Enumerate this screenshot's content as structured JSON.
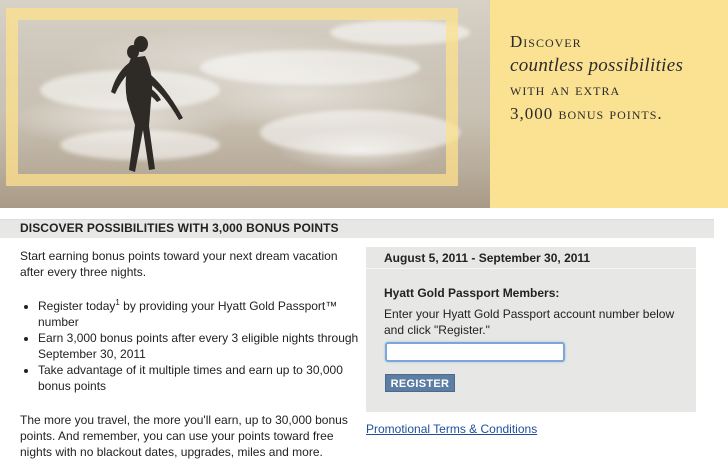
{
  "hero": {
    "panel_lines": [
      "Discover",
      "countless possibilities",
      "with an extra",
      "3,000 bonus points."
    ]
  },
  "section": {
    "title": "DISCOVER POSSIBILITIES WITH 3,000 BONUS POINTS"
  },
  "content": {
    "intro": "Start earning bonus points toward your next dream vacation after every three nights.",
    "bullets": [
      {
        "text_before": "Register today",
        "sup": "1",
        "text_after": " by providing your Hyatt Gold Passport™ number"
      },
      {
        "text": "Earn 3,000 bonus points after every 3 eligible nights through September 30, 2011"
      },
      {
        "text": "Take advantage of it multiple times and earn up to 30,000 bonus points"
      }
    ],
    "outro": "The more you travel, the more you'll earn, up to 30,000 bonus points. And remember, you can use your points toward free nights with no blackout dates, upgrades, miles and more."
  },
  "register_box": {
    "date_range": "August 5, 2011 - September 30, 2011",
    "heading": "Hyatt Gold Passport Members:",
    "instructions": "Enter your Hyatt Gold Passport account number below and click \"Register.\"",
    "account_value": "",
    "button_label": "REGISTER"
  },
  "terms_link": "Promotional Terms & Conditions",
  "colors": {
    "panel_bg": "#fbe192",
    "frame": "#fde28c",
    "section_bar": "#e7e7e5",
    "button": "#5d7ea3",
    "link": "#1f4f9b"
  }
}
